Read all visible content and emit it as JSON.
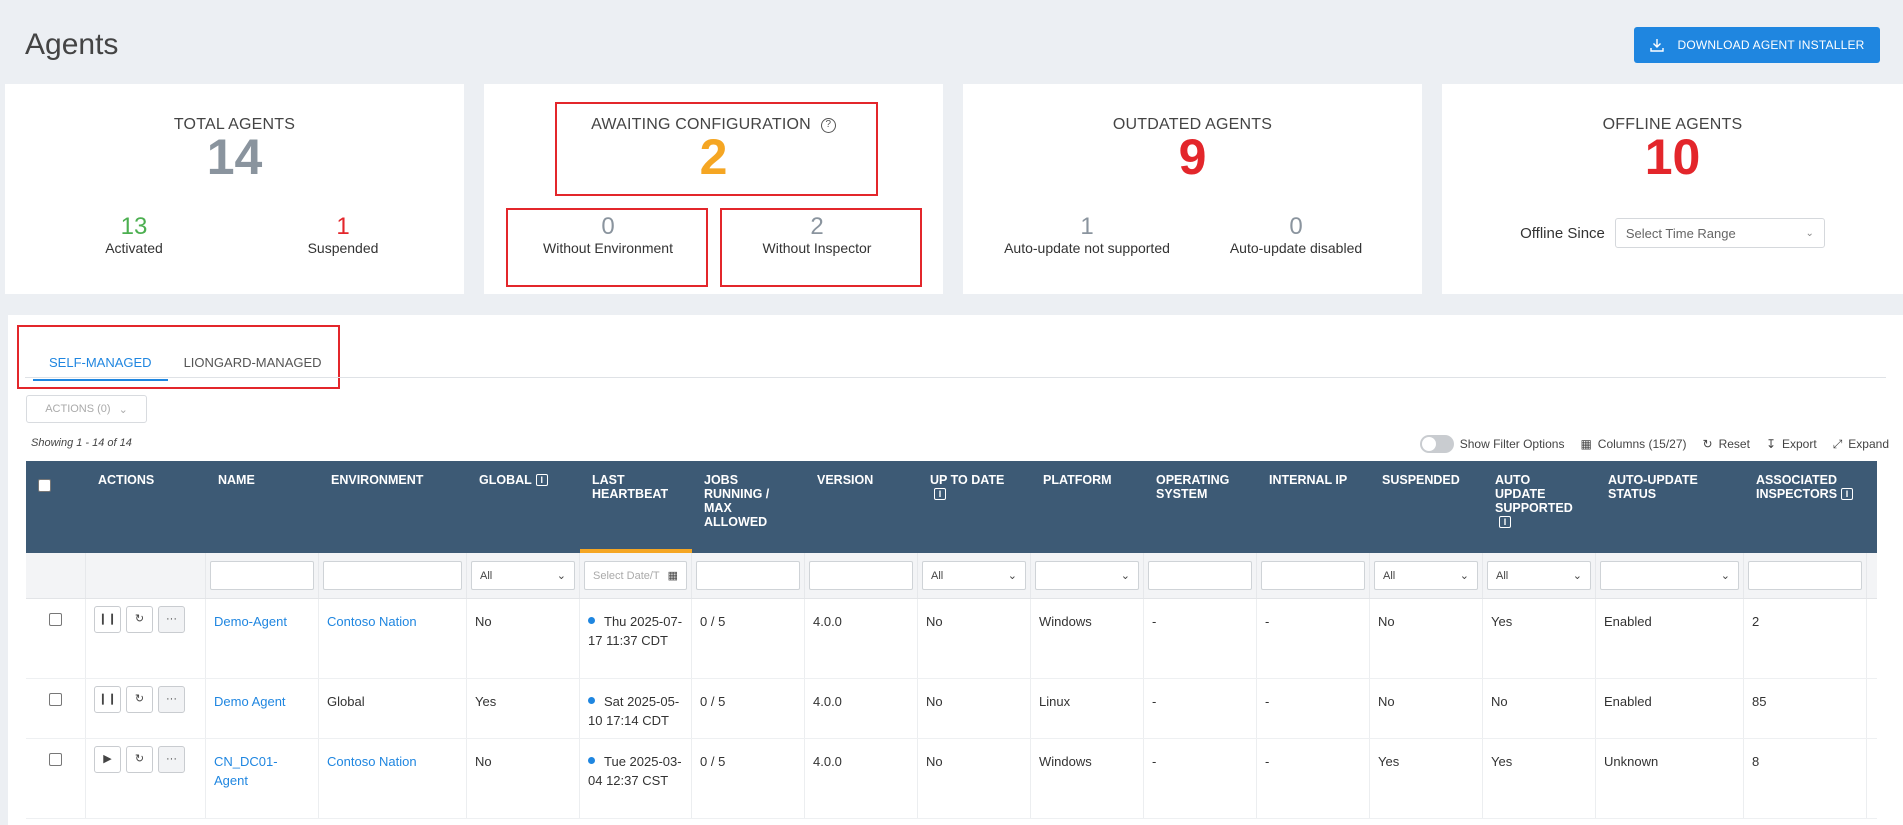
{
  "page": {
    "title": "Agents",
    "download_label": "DOWNLOAD AGENT INSTALLER"
  },
  "colors": {
    "accent": "#1f86e0",
    "header_bg": "#3d5a75",
    "green": "#4caf50",
    "red": "#e3262b",
    "orange": "#f5a623",
    "gray": "#8a949e"
  },
  "cards": {
    "total": {
      "title": "TOTAL AGENTS",
      "value": "14",
      "activated_value": "13",
      "activated_label": "Activated",
      "suspended_value": "1",
      "suspended_label": "Suspended"
    },
    "awaiting": {
      "title": "AWAITING CONFIGURATION",
      "value": "2",
      "without_env_value": "0",
      "without_env_label": "Without Environment",
      "without_insp_value": "2",
      "without_insp_label": "Without Inspector"
    },
    "outdated": {
      "title": "OUTDATED AGENTS",
      "value": "9",
      "not_supported_value": "1",
      "not_supported_label": "Auto-update not supported",
      "disabled_value": "0",
      "disabled_label": "Auto-update disabled"
    },
    "offline": {
      "title": "OFFLINE AGENTS",
      "value": "10",
      "since_label": "Offline Since",
      "range_placeholder": "Select Time Range"
    }
  },
  "tabs": {
    "self": "SELF-MANAGED",
    "liongard": "LIONGARD-MANAGED"
  },
  "actions_label": "ACTIONS (0)",
  "showing": "Showing 1 - 14 of 14",
  "toolbar": {
    "filter": "Show Filter Options",
    "columns": "Columns (15/27)",
    "reset": "Reset",
    "export": "Export",
    "expand": "Expand"
  },
  "columns": {
    "actions": "ACTIONS",
    "name": "NAME",
    "environment": "ENVIRONMENT",
    "global": "GLOBAL",
    "heartbeat": "LAST HEARTBEAT",
    "jobs": "JOBS RUNNING / MAX ALLOWED",
    "version": "VERSION",
    "uptodate": "UP TO DATE",
    "platform": "PLATFORM",
    "os": "OPERATING SYSTEM",
    "ip": "INTERNAL IP",
    "suspended": "SUSPENDED",
    "autoupdate": "AUTO UPDATE SUPPORTED",
    "autostatus": "AUTO-UPDATE STATUS",
    "inspectors": "ASSOCIATED INSPECTORS"
  },
  "filters": {
    "all": "All",
    "date_placeholder": "Select Date/T"
  },
  "rows": [
    {
      "name": "Demo-Agent",
      "environment": "Contoso Nation",
      "env_link": true,
      "global": "No",
      "heartbeat": "Thu 2025-07-17 11:37 CDT",
      "jobs": "0 / 5",
      "version": "4.0.0",
      "uptodate": "No",
      "platform": "Windows",
      "os": "-",
      "ip": "-",
      "suspended": "No",
      "autoupdate": "Yes",
      "autostatus": "Enabled",
      "inspectors": "2",
      "state": "pause"
    },
    {
      "name": "Demo Agent",
      "environment": "Global",
      "env_link": false,
      "global": "Yes",
      "heartbeat": "Sat 2025-05-10 17:14 CDT",
      "jobs": "0 / 5",
      "version": "4.0.0",
      "uptodate": "No",
      "platform": "Linux",
      "os": "-",
      "ip": "-",
      "suspended": "No",
      "autoupdate": "No",
      "autostatus": "Enabled",
      "inspectors": "85",
      "state": "pause"
    },
    {
      "name": "CN_DC01-Agent",
      "environment": "Contoso Nation",
      "env_link": true,
      "global": "No",
      "heartbeat": "Tue 2025-03-04 12:37 CST",
      "jobs": "0 / 5",
      "version": "4.0.0",
      "uptodate": "No",
      "platform": "Windows",
      "os": "-",
      "ip": "-",
      "suspended": "Yes",
      "autoupdate": "Yes",
      "autostatus": "Unknown",
      "inspectors": "8",
      "state": "play"
    }
  ]
}
